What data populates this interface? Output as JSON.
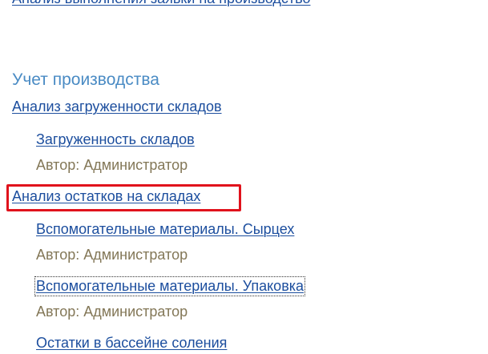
{
  "top_link": {
    "label": "Анализ выполнения заявки на производство"
  },
  "section": {
    "title": "Учет производства"
  },
  "groups": [
    {
      "label": "Анализ загруженности складов",
      "reports": [
        {
          "label": "Загруженность складов",
          "author": "Автор: Администратор"
        }
      ]
    },
    {
      "label": "Анализ остатков на складах",
      "highlighted": true,
      "highlight_color": "#e0121c",
      "reports": [
        {
          "label": "Вспомогательные материалы. Сырцех",
          "author": "Автор: Администратор"
        },
        {
          "label": "Вспомогательные материалы. Упаковка",
          "author": "Автор: Администратор",
          "focused": true
        },
        {
          "label": "Остатки в бассейне соления"
        }
      ]
    }
  ],
  "colors": {
    "link": "#1c4e9e",
    "section_title": "#4a8bc4",
    "author": "#837757"
  }
}
